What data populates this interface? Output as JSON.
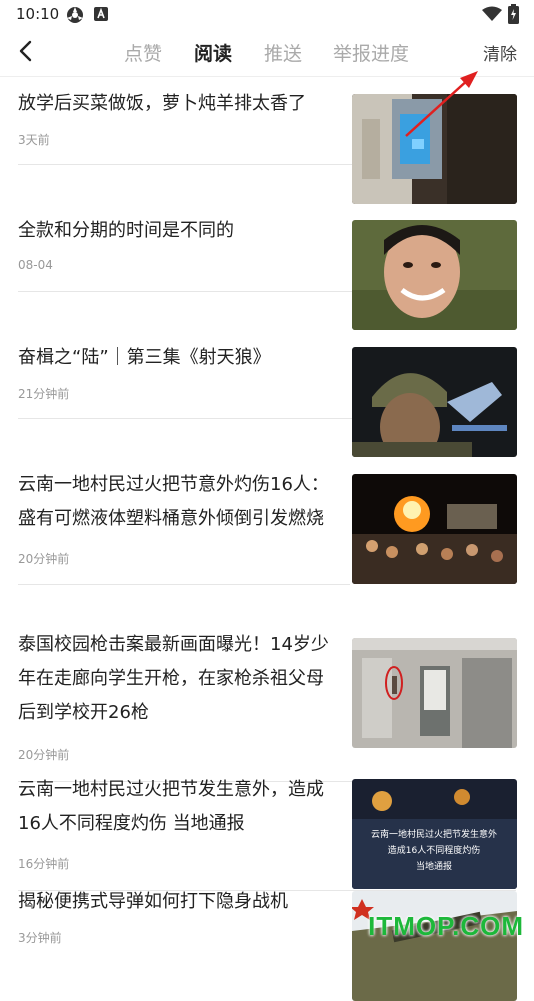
{
  "status_bar": {
    "time": "10:10",
    "icons": [
      "cast-icon",
      "a-badge-icon",
      "wifi-icon",
      "battery-icon"
    ]
  },
  "nav": {
    "tabs": [
      {
        "label": "点赞",
        "active": false
      },
      {
        "label": "阅读",
        "active": true
      },
      {
        "label": "推送",
        "active": false
      },
      {
        "label": "举报进度",
        "active": false
      }
    ],
    "clear_label": "清除"
  },
  "colors": {
    "annotation_arrow": "#e02020",
    "watermark": "#1db83a"
  },
  "items": [
    {
      "title": "放学后买菜做饭，萝卜炖羊排太香了",
      "time": "3天前",
      "thumb": "room-door-photo"
    },
    {
      "title": "全款和分期的时间是不同的",
      "time": "08-04",
      "thumb": "smiling-man-photo"
    },
    {
      "title": "奋楫之“陆”｜第三集《射天狼》",
      "time": "21分钟前",
      "thumb": "soldier-photo"
    },
    {
      "title": "云南一地村民过火把节意外灼伤16人：盛有可燃液体塑料桶意外倾倒引发燃烧",
      "time": "20分钟前",
      "thumb": "fire-festival-photo"
    },
    {
      "title": "泰国校园枪击案最新画面曝光！14岁少年在走廊向学生开枪，在家枪杀祖父母后到学校开26枪",
      "time": "20分钟前",
      "thumb": "school-corridor-photo"
    },
    {
      "title": "云南一地村民过火把节发生意外，造成16人不同程度灼伤 当地通报",
      "time": "16分钟前",
      "thumb": "news-caption-photo",
      "thumb_caption": "云南一地村民过火把节发生意外 造成16人不同程度灼伤 当地通报"
    },
    {
      "title": "揭秘便携式导弹如何打下隐身战机",
      "time": "3分钟前",
      "thumb": "missile-soldier-photo"
    }
  ],
  "watermark": "ITMOP.COM"
}
